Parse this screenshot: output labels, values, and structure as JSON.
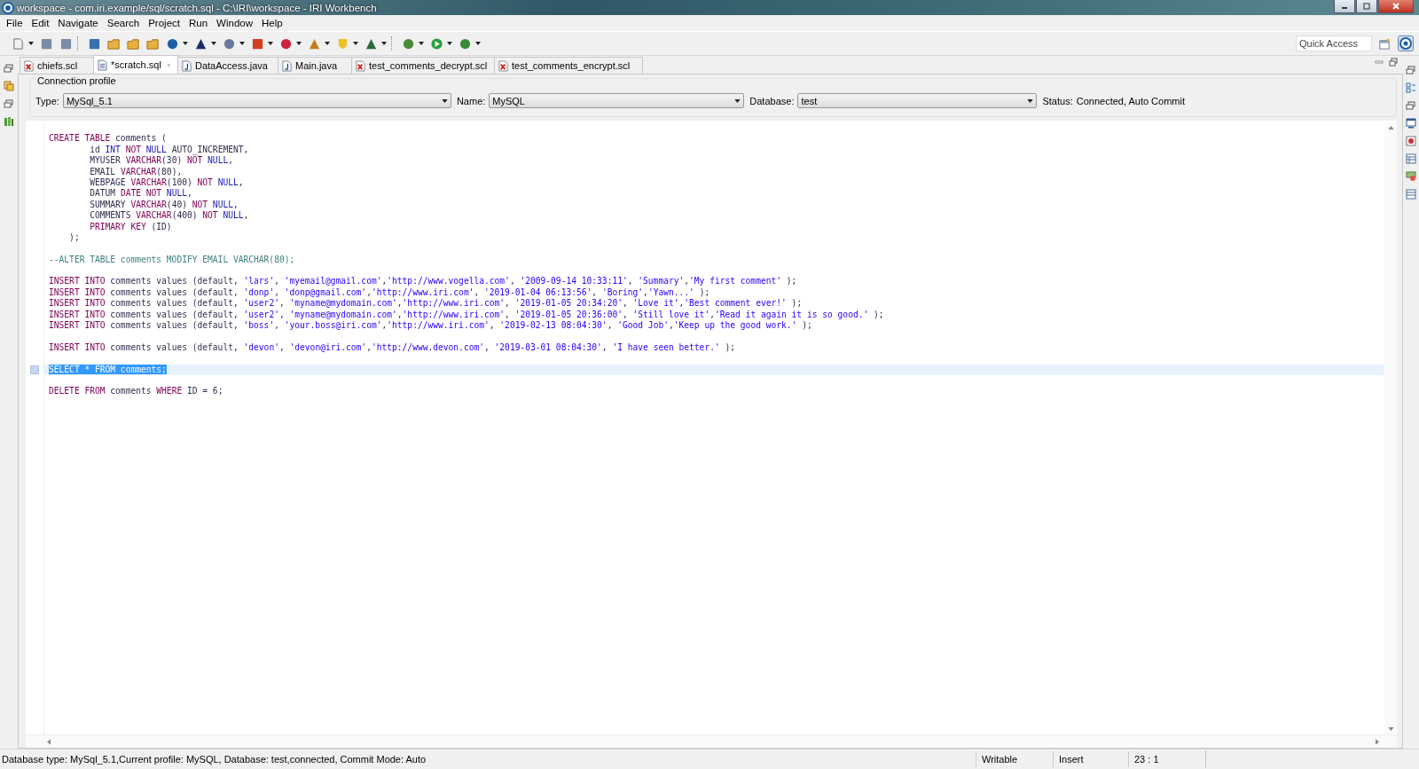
{
  "window": {
    "title": "workspace - com.iri.example/sql/scratch.sql - C:\\IRI\\workspace - IRI Workbench"
  },
  "menu": [
    "File",
    "Edit",
    "Navigate",
    "Search",
    "Project",
    "Run",
    "Window",
    "Help"
  ],
  "quick_access": {
    "placeholder": "Quick Access"
  },
  "tabs": [
    {
      "label": "chiefs.scl",
      "kind": "scl",
      "selected": false
    },
    {
      "label": "*scratch.sql",
      "kind": "sql",
      "selected": true
    },
    {
      "label": "DataAccess.java",
      "kind": "java",
      "selected": false
    },
    {
      "label": "Main.java",
      "kind": "java",
      "selected": false
    },
    {
      "label": "test_comments_decrypt.scl",
      "kind": "scl",
      "selected": false
    },
    {
      "label": "test_comments_encrypt.scl",
      "kind": "scl",
      "selected": false
    }
  ],
  "connection_profile": {
    "title": "Connection profile",
    "fields": [
      {
        "label": "Type:",
        "value": "MySql_5.1"
      },
      {
        "label": "Name:",
        "value": "MySQL"
      },
      {
        "label": "Database:",
        "value": "test"
      }
    ],
    "status_label": "Status:",
    "status": "Connected, Auto Commit"
  },
  "editor": {
    "lines": [
      {
        "kind": "blank",
        "selected": false
      },
      {
        "kind": "code",
        "selected": false,
        "tokens": [
          {
            "kind": "keyword",
            "text": "CREATE TABLE"
          },
          {
            "kind": "plain",
            "text": " comments ("
          }
        ]
      },
      {
        "kind": "code",
        "selected": false,
        "tokens": [
          {
            "kind": "plain",
            "text": "        id "
          },
          {
            "kind": "type",
            "text": "INT "
          },
          {
            "kind": "keyword",
            "text": "NOT "
          },
          {
            "kind": "type",
            "text": "NULL"
          },
          {
            "kind": "plain",
            "text": " AUTO_INCREMENT,"
          }
        ]
      },
      {
        "kind": "code",
        "selected": false,
        "tokens": [
          {
            "kind": "plain",
            "text": "        MYUSER "
          },
          {
            "kind": "keyword",
            "text": "VARCHAR"
          },
          {
            "kind": "plain",
            "text": "(30) "
          },
          {
            "kind": "keyword",
            "text": "NOT "
          },
          {
            "kind": "type",
            "text": "NULL"
          },
          {
            "kind": "plain",
            "text": ","
          }
        ]
      },
      {
        "kind": "code",
        "selected": false,
        "tokens": [
          {
            "kind": "plain",
            "text": "        EMAIL "
          },
          {
            "kind": "keyword",
            "text": "VARCHAR"
          },
          {
            "kind": "plain",
            "text": "(80),"
          }
        ]
      },
      {
        "kind": "code",
        "selected": false,
        "tokens": [
          {
            "kind": "plain",
            "text": "        WEBPAGE "
          },
          {
            "kind": "keyword",
            "text": "VARCHAR"
          },
          {
            "kind": "plain",
            "text": "(100) "
          },
          {
            "kind": "keyword",
            "text": "NOT "
          },
          {
            "kind": "type",
            "text": "NULL"
          },
          {
            "kind": "plain",
            "text": ","
          }
        ]
      },
      {
        "kind": "code",
        "selected": false,
        "tokens": [
          {
            "kind": "plain",
            "text": "        DATUM "
          },
          {
            "kind": "keyword",
            "text": "DATE NOT "
          },
          {
            "kind": "type",
            "text": "NULL"
          },
          {
            "kind": "plain",
            "text": ","
          }
        ]
      },
      {
        "kind": "code",
        "selected": false,
        "tokens": [
          {
            "kind": "plain",
            "text": "        SUMMARY "
          },
          {
            "kind": "keyword",
            "text": "VARCHAR"
          },
          {
            "kind": "plain",
            "text": "(40) "
          },
          {
            "kind": "keyword",
            "text": "NOT "
          },
          {
            "kind": "type",
            "text": "NULL"
          },
          {
            "kind": "plain",
            "text": ","
          }
        ]
      },
      {
        "kind": "code",
        "selected": false,
        "tokens": [
          {
            "kind": "plain",
            "text": "        COMMENTS "
          },
          {
            "kind": "keyword",
            "text": "VARCHAR"
          },
          {
            "kind": "plain",
            "text": "(400) "
          },
          {
            "kind": "keyword",
            "text": "NOT "
          },
          {
            "kind": "type",
            "text": "NULL"
          },
          {
            "kind": "plain",
            "text": ","
          }
        ]
      },
      {
        "kind": "code",
        "selected": false,
        "tokens": [
          {
            "kind": "keyword",
            "text": "        PRIMARY KEY"
          },
          {
            "kind": "plain",
            "text": " (ID)"
          }
        ]
      },
      {
        "kind": "code",
        "selected": false,
        "tokens": [
          {
            "kind": "plain",
            "text": "    );"
          }
        ]
      },
      {
        "kind": "blank",
        "selected": false
      },
      {
        "kind": "code",
        "selected": false,
        "tokens": [
          {
            "kind": "comment",
            "text": "--ALTER TABLE comments MODIFY EMAIL VARCHAR(80);"
          }
        ]
      },
      {
        "kind": "blank",
        "selected": false
      },
      {
        "kind": "code",
        "selected": false,
        "tokens": [
          {
            "kind": "keyword",
            "text": "INSERT INTO"
          },
          {
            "kind": "plain",
            "text": " comments values (default, "
          },
          {
            "kind": "string",
            "text": "'lars'"
          },
          {
            "kind": "plain",
            "text": ", "
          },
          {
            "kind": "string",
            "text": "'myemail@gmail.com'"
          },
          {
            "kind": "plain",
            "text": ","
          },
          {
            "kind": "string",
            "text": "'http://www.vogella.com'"
          },
          {
            "kind": "plain",
            "text": ", "
          },
          {
            "kind": "string",
            "text": "'2009-09-14 10:33:11'"
          },
          {
            "kind": "plain",
            "text": ", "
          },
          {
            "kind": "string",
            "text": "'Summary'"
          },
          {
            "kind": "plain",
            "text": ","
          },
          {
            "kind": "string",
            "text": "'My first comment'"
          },
          {
            "kind": "plain",
            "text": " );"
          }
        ]
      },
      {
        "kind": "code",
        "selected": false,
        "tokens": [
          {
            "kind": "keyword",
            "text": "INSERT INTO"
          },
          {
            "kind": "plain",
            "text": " comments values (default, "
          },
          {
            "kind": "string",
            "text": "'donp'"
          },
          {
            "kind": "plain",
            "text": ", "
          },
          {
            "kind": "string",
            "text": "'donp@gmail.com'"
          },
          {
            "kind": "plain",
            "text": ","
          },
          {
            "kind": "string",
            "text": "'http://www.iri.com'"
          },
          {
            "kind": "plain",
            "text": ", "
          },
          {
            "kind": "string",
            "text": "'2019-01-04 06:13:56'"
          },
          {
            "kind": "plain",
            "text": ", "
          },
          {
            "kind": "string",
            "text": "'Boring'"
          },
          {
            "kind": "plain",
            "text": ","
          },
          {
            "kind": "string",
            "text": "'Yawn...'"
          },
          {
            "kind": "plain",
            "text": " );"
          }
        ]
      },
      {
        "kind": "code",
        "selected": false,
        "tokens": [
          {
            "kind": "keyword",
            "text": "INSERT INTO"
          },
          {
            "kind": "plain",
            "text": " comments values (default, "
          },
          {
            "kind": "string",
            "text": "'user2'"
          },
          {
            "kind": "plain",
            "text": ", "
          },
          {
            "kind": "string",
            "text": "'myname@mydomain.com'"
          },
          {
            "kind": "plain",
            "text": ","
          },
          {
            "kind": "string",
            "text": "'http://www.iri.com'"
          },
          {
            "kind": "plain",
            "text": ", "
          },
          {
            "kind": "string",
            "text": "'2019-01-05 20:34:20'"
          },
          {
            "kind": "plain",
            "text": ", "
          },
          {
            "kind": "string",
            "text": "'Love it'"
          },
          {
            "kind": "plain",
            "text": ","
          },
          {
            "kind": "string",
            "text": "'Best comment ever!'"
          },
          {
            "kind": "plain",
            "text": " );"
          }
        ]
      },
      {
        "kind": "code",
        "selected": false,
        "tokens": [
          {
            "kind": "keyword",
            "text": "INSERT INTO"
          },
          {
            "kind": "plain",
            "text": " comments values (default, "
          },
          {
            "kind": "string",
            "text": "'user2'"
          },
          {
            "kind": "plain",
            "text": ", "
          },
          {
            "kind": "string",
            "text": "'myname@mydomain.com'"
          },
          {
            "kind": "plain",
            "text": ","
          },
          {
            "kind": "string",
            "text": "'http://www.iri.com'"
          },
          {
            "kind": "plain",
            "text": ", "
          },
          {
            "kind": "string",
            "text": "'2019-01-05 20:36:00'"
          },
          {
            "kind": "plain",
            "text": ", "
          },
          {
            "kind": "string",
            "text": "'Still love it'"
          },
          {
            "kind": "plain",
            "text": ","
          },
          {
            "kind": "string",
            "text": "'Read it again it is so good.'"
          },
          {
            "kind": "plain",
            "text": " );"
          }
        ]
      },
      {
        "kind": "code",
        "selected": false,
        "tokens": [
          {
            "kind": "keyword",
            "text": "INSERT INTO"
          },
          {
            "kind": "plain",
            "text": " comments values (default, "
          },
          {
            "kind": "string",
            "text": "'boss'"
          },
          {
            "kind": "plain",
            "text": ", "
          },
          {
            "kind": "string",
            "text": "'your.boss@iri.com'"
          },
          {
            "kind": "plain",
            "text": ","
          },
          {
            "kind": "string",
            "text": "'http://www.iri.com'"
          },
          {
            "kind": "plain",
            "text": ", "
          },
          {
            "kind": "string",
            "text": "'2019-02-13 08:04:30'"
          },
          {
            "kind": "plain",
            "text": ", "
          },
          {
            "kind": "string",
            "text": "'Good Job'"
          },
          {
            "kind": "plain",
            "text": ","
          },
          {
            "kind": "string",
            "text": "'Keep up the good work.'"
          },
          {
            "kind": "plain",
            "text": " );"
          }
        ]
      },
      {
        "kind": "blank",
        "selected": false
      },
      {
        "kind": "code",
        "selected": false,
        "tokens": [
          {
            "kind": "keyword",
            "text": "INSERT INTO"
          },
          {
            "kind": "plain",
            "text": " comments values (default, "
          },
          {
            "kind": "string",
            "text": "'devon'"
          },
          {
            "kind": "plain",
            "text": ", "
          },
          {
            "kind": "string",
            "text": "'devon@iri.com'"
          },
          {
            "kind": "plain",
            "text": ","
          },
          {
            "kind": "string",
            "text": "'http://www.devon.com'"
          },
          {
            "kind": "plain",
            "text": ", "
          },
          {
            "kind": "string",
            "text": "'2019-03-01 08:04:30'"
          },
          {
            "kind": "plain",
            "text": ", "
          },
          {
            "kind": "string",
            "text": "'I have seen better.'"
          },
          {
            "kind": "plain",
            "text": " );"
          }
        ]
      },
      {
        "kind": "blank",
        "selected": false
      },
      {
        "kind": "code",
        "selected": true,
        "tokens": [
          {
            "kind": "keyword",
            "text": "SELECT"
          },
          {
            "kind": "plain",
            "text": " * "
          },
          {
            "kind": "keyword",
            "text": "FROM"
          },
          {
            "kind": "plain",
            "text": " comments;"
          }
        ]
      },
      {
        "kind": "blank",
        "selected": false
      },
      {
        "kind": "code",
        "selected": false,
        "tokens": [
          {
            "kind": "keyword",
            "text": "DELETE FROM"
          },
          {
            "kind": "plain",
            "text": " comments "
          },
          {
            "kind": "keyword",
            "text": "WHERE"
          },
          {
            "kind": "plain",
            "text": " ID = 6;"
          }
        ]
      }
    ]
  },
  "status_bar": {
    "message": "Database type: MySql_5.1,Current profile: MySQL, Database: test,connected, Commit Mode: Auto",
    "write_mode": "Writable",
    "insert_mode": "Insert",
    "position": "23 : 1"
  }
}
